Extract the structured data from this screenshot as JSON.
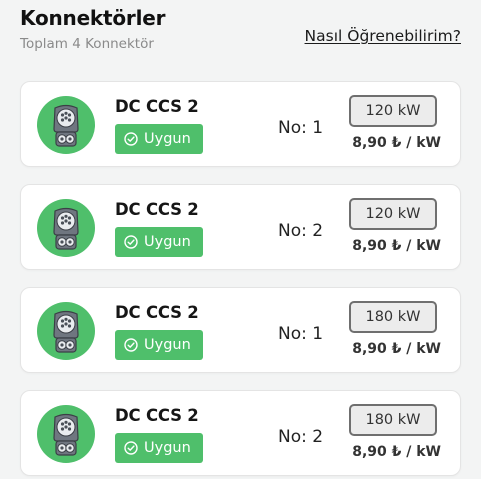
{
  "header": {
    "title": "Konnektörler",
    "subtitle": "Toplam 4 Konnektör",
    "help_link": "Nasıl Öğrenebilirim?"
  },
  "colors": {
    "accent_green": "#4fbf6b",
    "background": "#f3f4f4"
  },
  "connectors": [
    {
      "name": "DC CCS 2",
      "status": "Uygun",
      "number": "No: 1",
      "power": "120 kW",
      "price": "8,90 ₺ / kW",
      "icon": "ccs2-connector-icon"
    },
    {
      "name": "DC CCS 2",
      "status": "Uygun",
      "number": "No: 2",
      "power": "120 kW",
      "price": "8,90 ₺ / kW",
      "icon": "ccs2-connector-icon"
    },
    {
      "name": "DC CCS 2",
      "status": "Uygun",
      "number": "No: 1",
      "power": "180 kW",
      "price": "8,90 ₺ / kW",
      "icon": "ccs2-connector-icon"
    },
    {
      "name": "DC CCS 2",
      "status": "Uygun",
      "number": "No: 2",
      "power": "180 kW",
      "price": "8,90 ₺ / kW",
      "icon": "ccs2-connector-icon"
    }
  ]
}
